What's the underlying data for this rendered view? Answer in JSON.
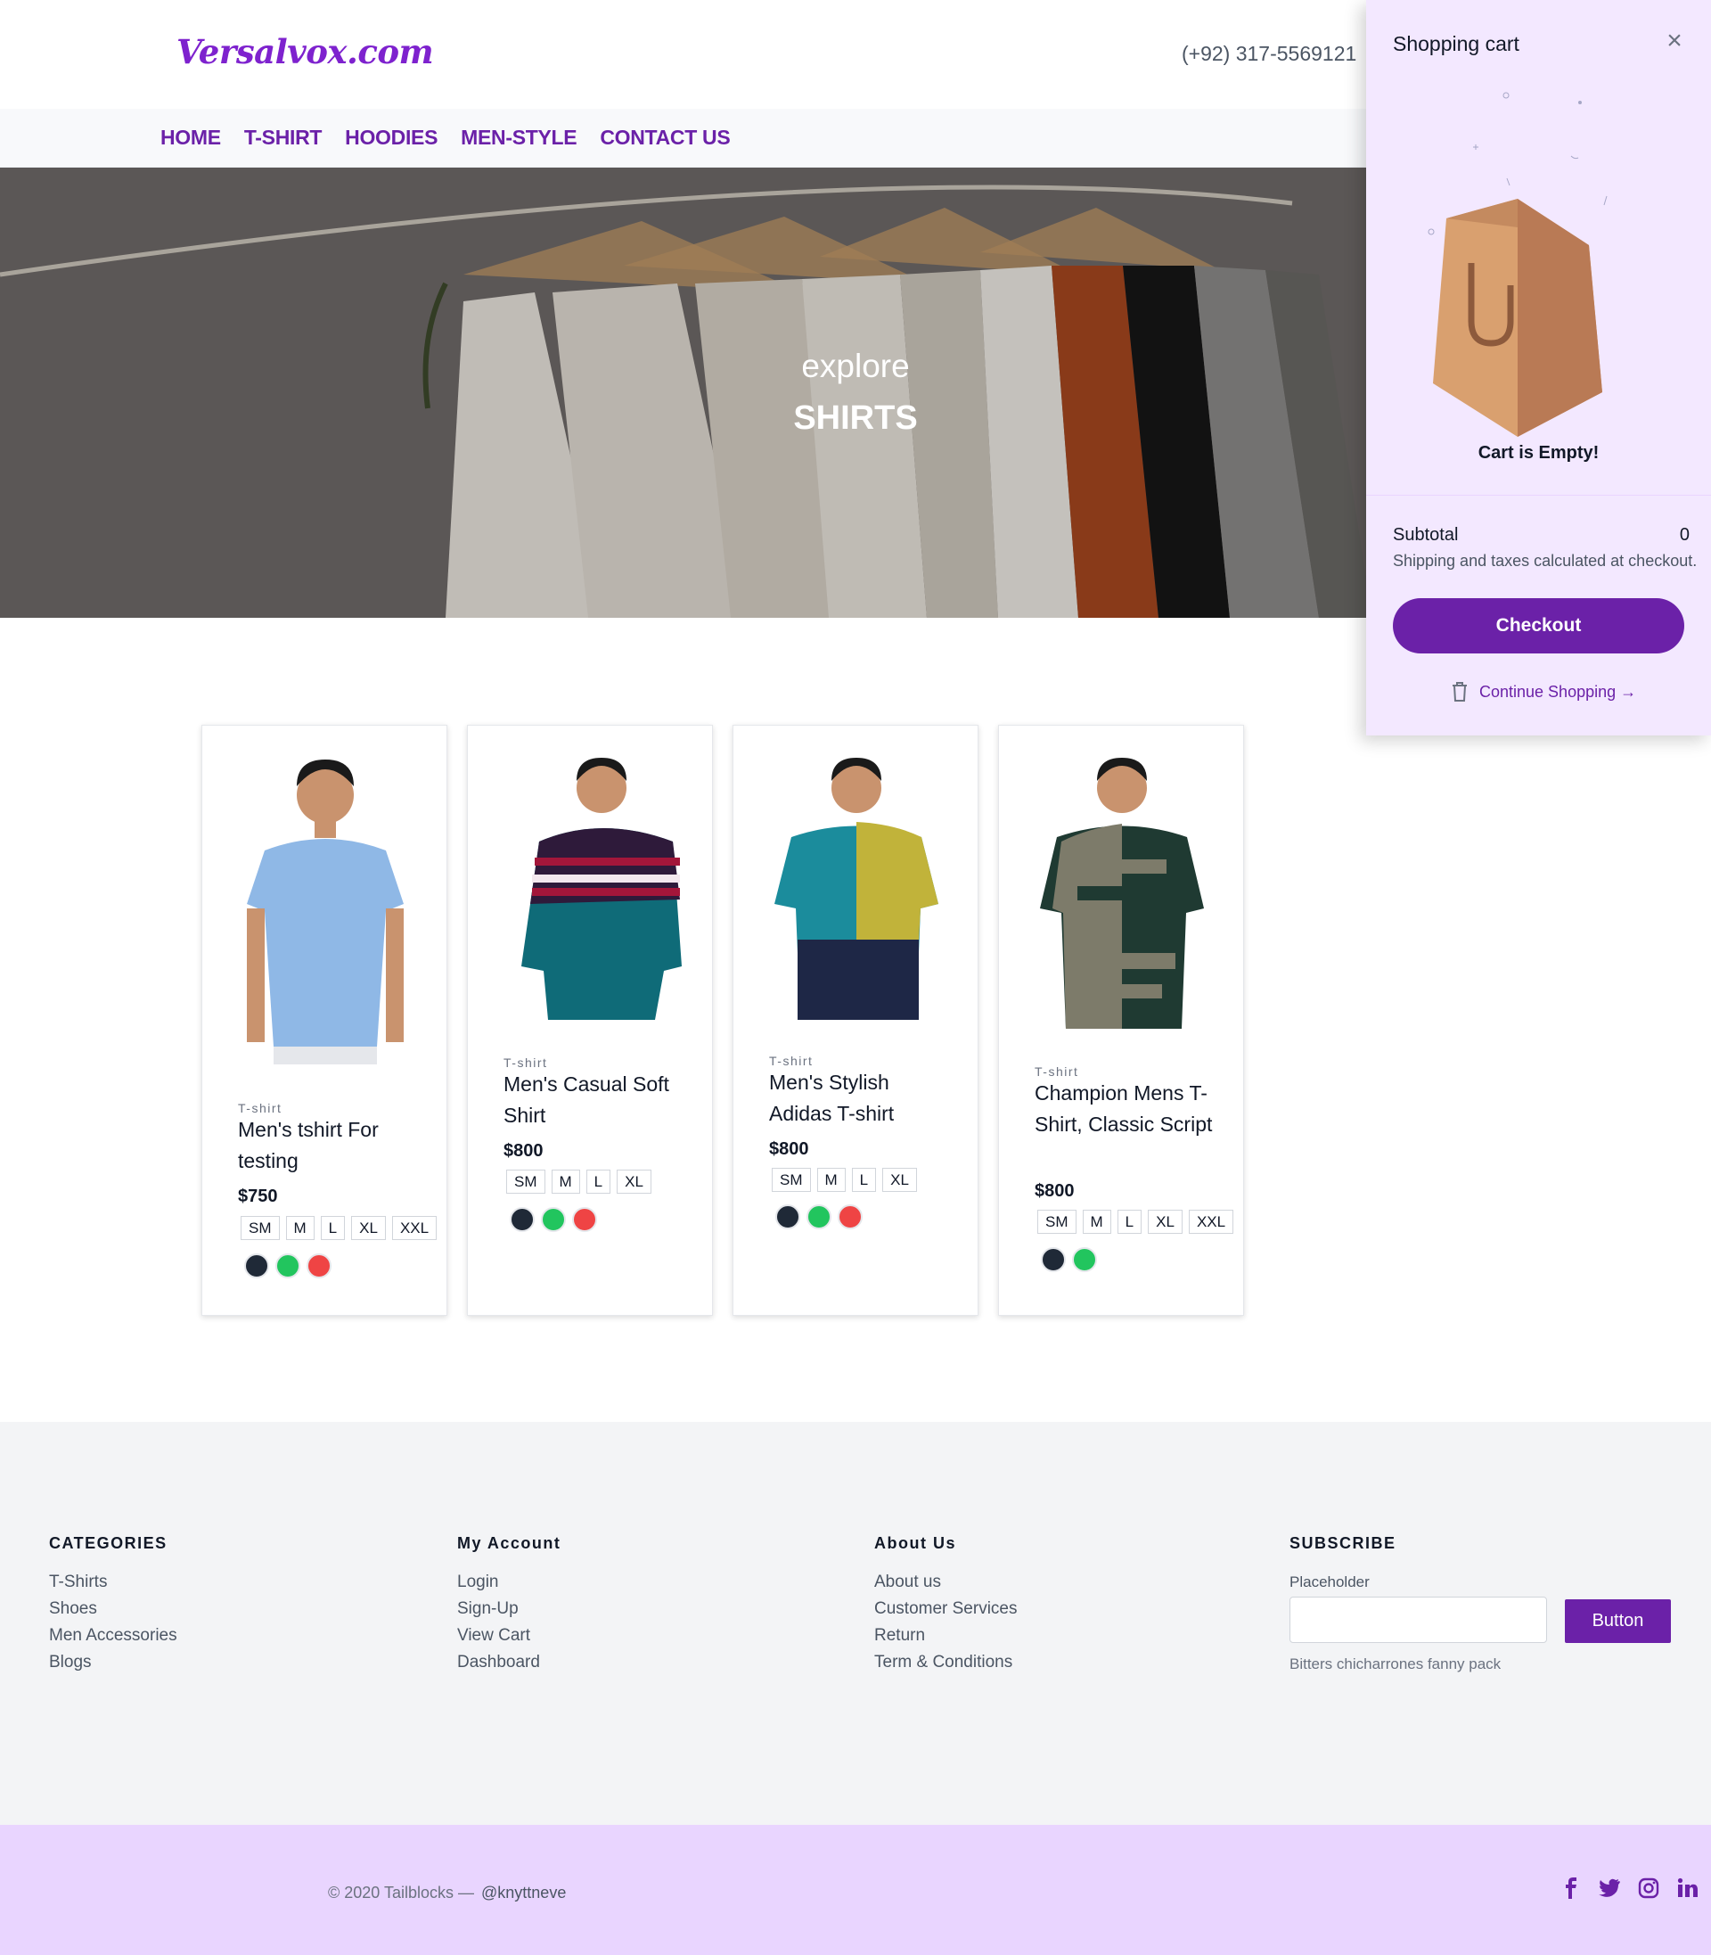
{
  "brand": {
    "logo": "Versalvox.com",
    "phone": "(+92) 317-5569121"
  },
  "nav": [
    "HOME",
    "T-SHIRT",
    "HOODIES",
    "MEN-STYLE",
    "CONTACT US"
  ],
  "hero": {
    "subtitle": "explore",
    "title": "SHIRTS"
  },
  "products": [
    {
      "category": "T-shirt",
      "name": "Men's tshirt For testing",
      "price": "$750",
      "sizes": [
        "SM",
        "M",
        "L",
        "XL",
        "XXL"
      ],
      "colors": [
        "#1f2937",
        "#22c55e",
        "#ef4444"
      ],
      "shirt_color": "#8fb8e6"
    },
    {
      "category": "T-shirt",
      "name": "Men's Casual Soft Shirt",
      "price": "$800",
      "sizes": [
        "SM",
        "M",
        "L",
        "XL"
      ],
      "colors": [
        "#1f2937",
        "#22c55e",
        "#ef4444"
      ],
      "shirt_color": "#0f6b78"
    },
    {
      "category": "T-shirt",
      "name": "Men's Stylish Adidas T-shirt",
      "price": "$800",
      "sizes": [
        "SM",
        "M",
        "L",
        "XL"
      ],
      "colors": [
        "#1f2937",
        "#22c55e",
        "#ef4444"
      ],
      "shirt_color": "#1b8c9c"
    },
    {
      "category": "T-shirt",
      "name": "Champion Mens T-Shirt, Classic Script",
      "price": "$800",
      "sizes": [
        "SM",
        "M",
        "L",
        "XL",
        "XXL"
      ],
      "colors": [
        "#1f2937",
        "#22c55e"
      ],
      "shirt_color": "#1f3a32"
    }
  ],
  "cart": {
    "title": "Shopping cart",
    "close_icon": "×",
    "empty_text": "Cart is Empty!",
    "subtotal_label": "Subtotal",
    "subtotal_value": "0",
    "shipping_note": "Shipping and taxes calculated at checkout.",
    "checkout_label": "Checkout",
    "continue_label": "Continue Shopping →"
  },
  "footer": {
    "columns": [
      {
        "heading": "CATEGORIES",
        "links": [
          "T-Shirts",
          "Shoes",
          "Men Accessories",
          "Blogs"
        ]
      },
      {
        "heading": "My Account",
        "links": [
          "Login",
          "Sign-Up",
          "View Cart",
          "Dashboard"
        ]
      },
      {
        "heading": "About Us",
        "links": [
          "About us",
          "Customer Services",
          "Return",
          "Term & Conditions"
        ]
      }
    ],
    "subscribe": {
      "heading": "SUBSCRIBE",
      "label": "Placeholder",
      "button": "Button",
      "note": "Bitters chicharrones fanny pack"
    },
    "copyright": "© 2020 Tailblocks —",
    "handle": "@knyttneve",
    "social": [
      "facebook-icon",
      "twitter-icon",
      "instagram-icon",
      "linkedin-icon"
    ]
  },
  "colors": {
    "accent": "#6b21a8",
    "drawer_bg": "#f3e8ff",
    "footer_bottom": "#e9d5ff"
  }
}
